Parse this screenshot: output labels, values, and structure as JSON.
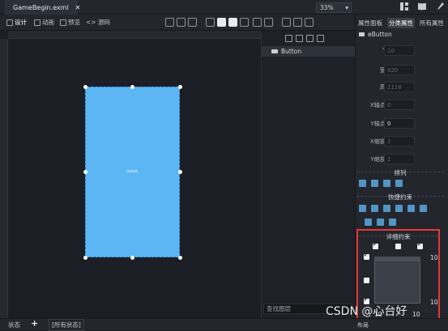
{
  "tabs": {
    "file_name": "GameBegin.exml",
    "close_glyph": "✕"
  },
  "toolbar": {
    "design_label": "设计",
    "animation_label": "动画",
    "preview_label": "预览",
    "source_label": "<> 源码",
    "zoom_value": "33%"
  },
  "canvas": {
    "button_text": "Button"
  },
  "layers": {
    "item_label": "Button",
    "search_placeholder": "查找图层"
  },
  "properties": {
    "tab_panel": "属性面板",
    "tab_category": "分类属性",
    "tab_all": "所有属性",
    "component_name": "eButton",
    "rows": [
      {
        "label": "Y:",
        "value": "10",
        "placeholder": true
      },
      {
        "label": "宽:",
        "value": "620",
        "placeholder": true
      },
      {
        "label": "高:",
        "value": "1116",
        "placeholder": true
      },
      {
        "label": "X轴点:",
        "value": "0",
        "placeholder": true
      },
      {
        "label": "Y轴点:",
        "value": "0",
        "placeholder": false
      },
      {
        "label": "X缩放:",
        "value": "1",
        "placeholder": true
      },
      {
        "label": "Y缩放:",
        "value": "1",
        "placeholder": true
      }
    ],
    "section_arrange": "排列",
    "section_quick": "快捷约束",
    "section_detail": "详细约束",
    "constraint_top": "10",
    "constraint_bottom": "10",
    "constraint_right_top": "10",
    "constraint_right_bottom": "10",
    "layout_label": "布局"
  },
  "status": {
    "label": "状态",
    "plus": "+",
    "all_states": "[所有状态]"
  },
  "watermark": "CSDN @心台好",
  "colors": {
    "button_fill": "#5cb6f4",
    "highlight_border": "#e53935"
  }
}
